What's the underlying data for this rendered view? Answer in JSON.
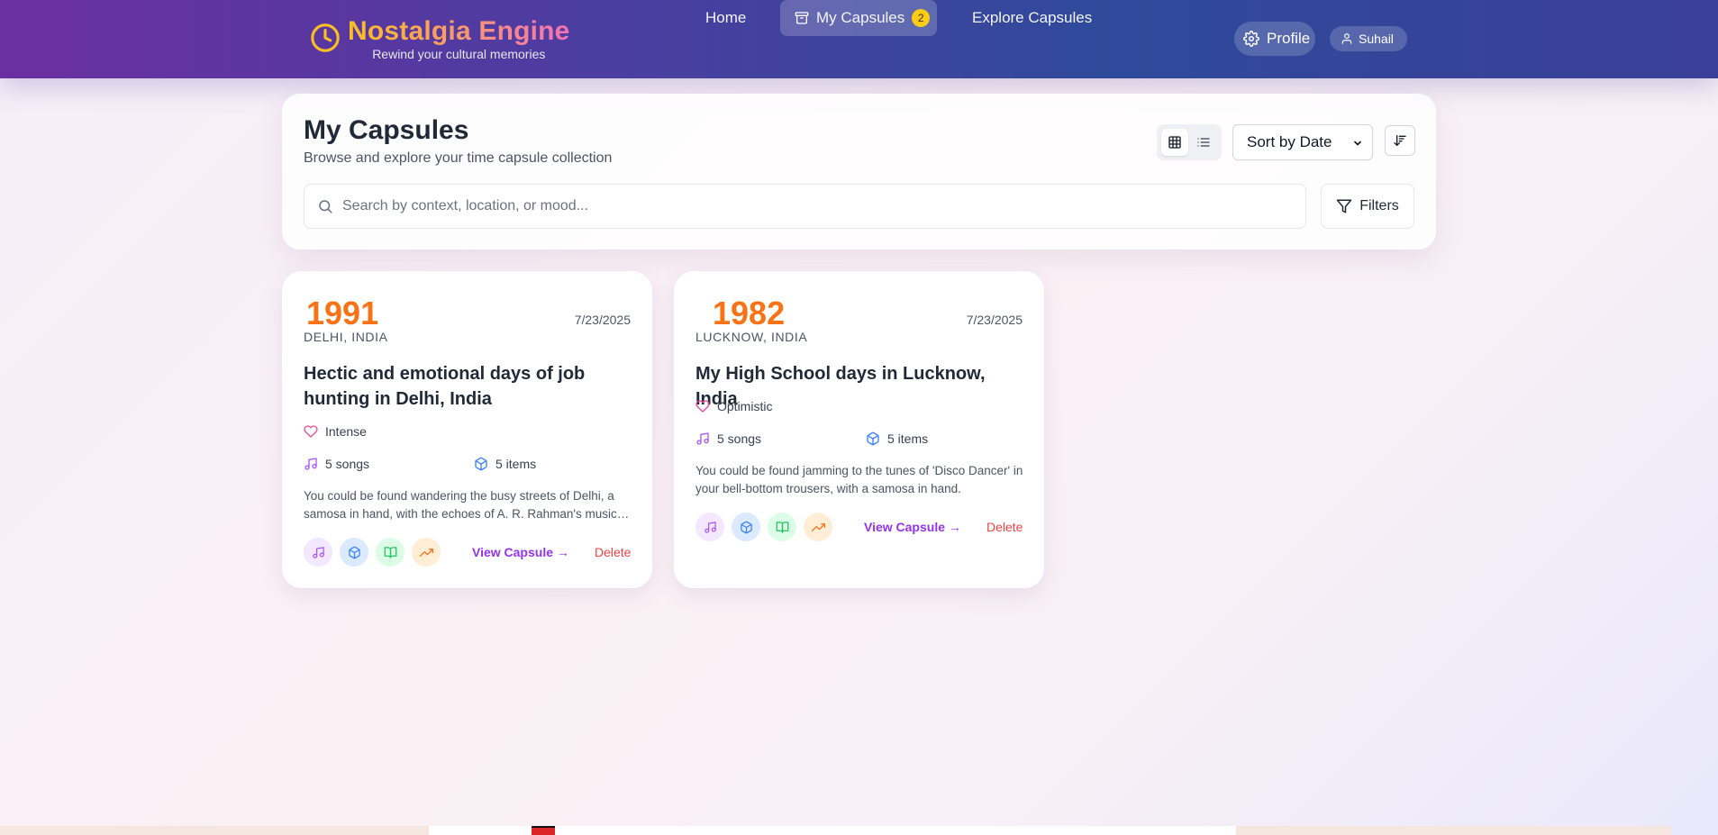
{
  "header": {
    "title": "Nostalgia Engine",
    "subtitle": "Rewind your cultural memories",
    "nav": [
      {
        "label": "Home"
      },
      {
        "label": "My Capsules",
        "badge": "2"
      },
      {
        "label": "Explore Capsules"
      }
    ],
    "profile_label": "Profile",
    "user_name": "Suhail"
  },
  "page": {
    "title": "My Capsules",
    "subtitle": "Browse and explore your time capsule collection",
    "sort_value": "Sort by Date",
    "search_placeholder": "Search by context, location, or mood...",
    "filters_label": "Filters"
  },
  "capsules": [
    {
      "year": "1991",
      "location": "DELHI, INDIA",
      "date": "7/23/2025",
      "title": "Hectic and emotional days of job hunting in Delhi, India",
      "mood": "Intense",
      "songs": "5 songs",
      "items": "5 items",
      "description": "You could be found wandering the busy streets of Delhi, a samosa in hand, with the echoes of A. R. Rahman's music filling the air.",
      "view_label": "View Capsule →",
      "delete_label": "Delete"
    },
    {
      "year": "1982",
      "location": "LUCKNOW, INDIA",
      "date": "7/23/2025",
      "title": "My High School days in Lucknow, India",
      "mood": "Optimistic",
      "songs": "5 songs",
      "items": "5 items",
      "description": "You could be found jamming to the tunes of 'Disco Dancer' in your bell-bottom trousers, with a samosa in hand.",
      "view_label": "View Capsule →",
      "delete_label": "Delete"
    }
  ],
  "colors": {
    "accent_orange": "#f97316",
    "link_purple": "#9333ea",
    "delete_red": "#ef4444",
    "badge_yellow": "#facc15"
  }
}
